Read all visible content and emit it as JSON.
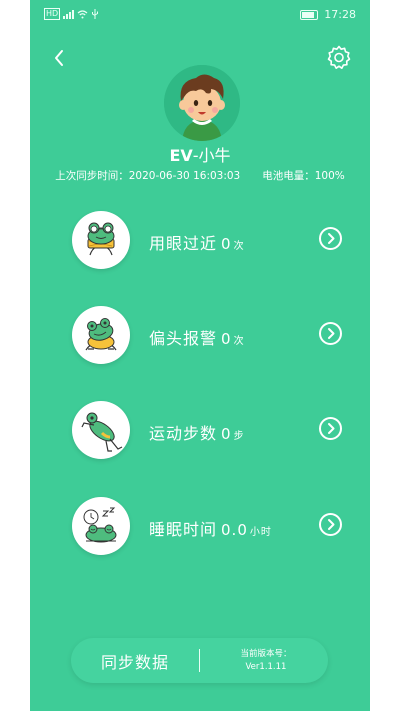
{
  "status_bar": {
    "indicator": "HD",
    "time": "17:28"
  },
  "header": {
    "back_icon": "chevron-left-icon",
    "settings_icon": "gear-icon"
  },
  "profile": {
    "name_prefix": "EV",
    "name_suffix": "-小牛",
    "last_sync": "上次同步时间：2020-06-30 16:03:03",
    "battery": "电池电量：100%"
  },
  "metrics": [
    {
      "label": "用眼过近",
      "value": "0",
      "unit": "次",
      "icon": "frog-glasses-icon"
    },
    {
      "label": "偏头报警",
      "value": "0",
      "unit": "次",
      "icon": "frog-tilt-icon"
    },
    {
      "label": "运动步数",
      "value": "0",
      "unit": "步",
      "icon": "frog-jump-icon"
    },
    {
      "label": "睡眠时间",
      "value": "0.0",
      "unit": "小时",
      "icon": "frog-sleep-icon"
    }
  ],
  "footer": {
    "sync_label": "同步数据",
    "version_label": "当前版本号：",
    "version_value": "Ver1.1.11"
  },
  "colors": {
    "primary": "#3ecc97",
    "frog_green": "#4ebc7e",
    "frog_yellow": "#f6c23a"
  }
}
